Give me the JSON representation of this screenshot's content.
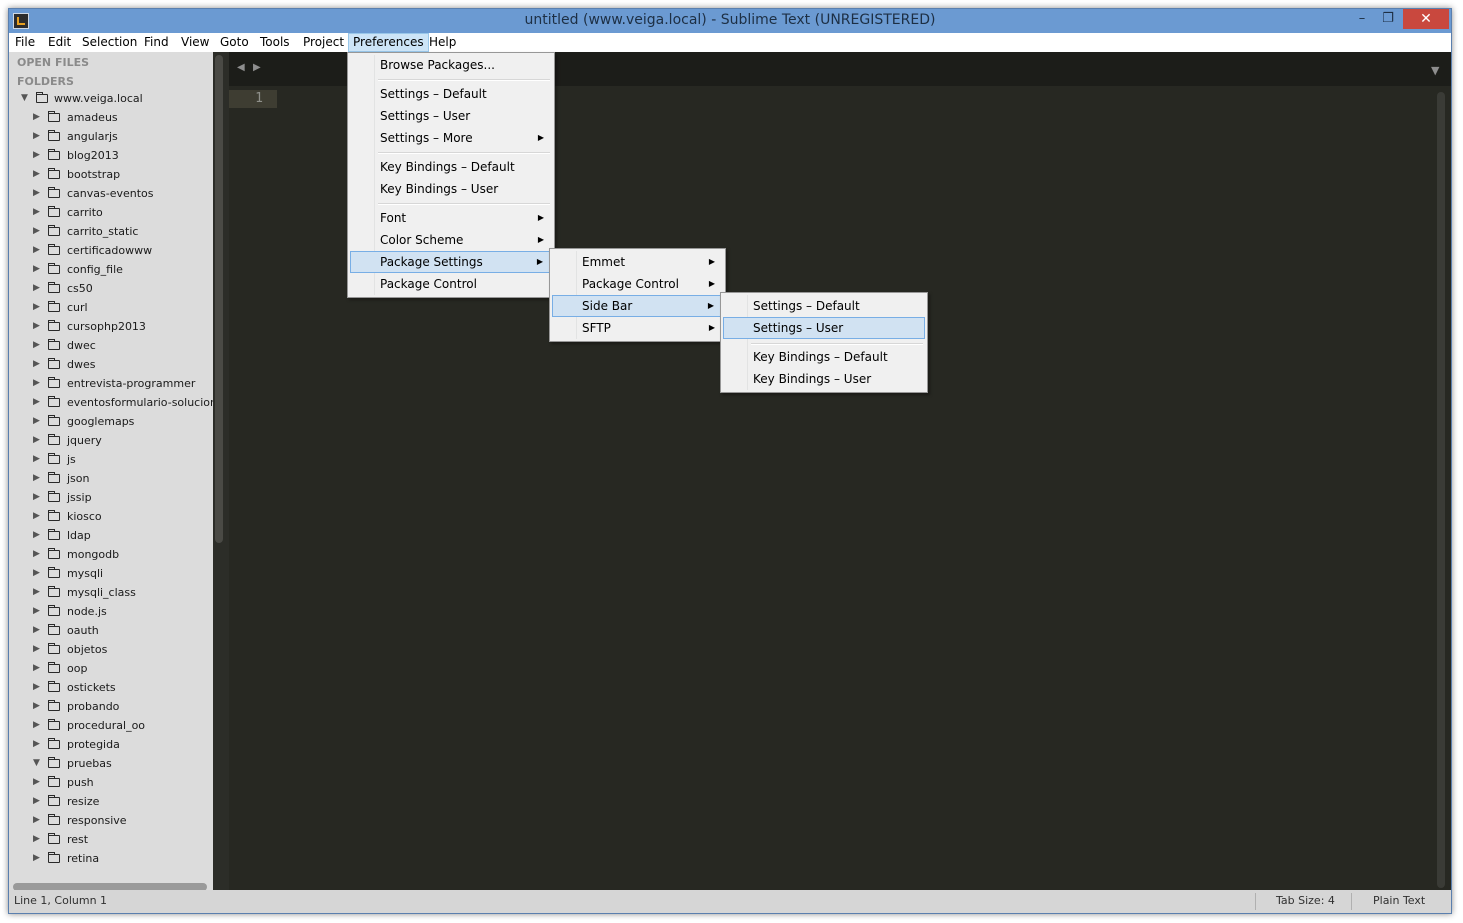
{
  "window": {
    "title": "untitled (www.veiga.local) - Sublime Text (UNREGISTERED)",
    "controls": {
      "minimize": "–",
      "maximize": "❐",
      "close": "✕"
    }
  },
  "menubar": [
    "File",
    "Edit",
    "Selection",
    "Find",
    "View",
    "Goto",
    "Tools",
    "Project",
    "Preferences",
    "Help"
  ],
  "sidebar": {
    "open_files_label": "OPEN FILES",
    "folders_label": "FOLDERS",
    "root": "www.veiga.local",
    "folders": [
      "amadeus",
      "angularjs",
      "blog2013",
      "bootstrap",
      "canvas-eventos",
      "carrito",
      "carrito_static",
      "certificadowww",
      "config_file",
      "cs50",
      "curl",
      "cursophp2013",
      "dwec",
      "dwes",
      "entrevista-programmer",
      "eventosformulario-solucion",
      "googlemaps",
      "jquery",
      "js",
      "json",
      "jssip",
      "kiosco",
      "ldap",
      "mongodb",
      "mysqli",
      "mysqli_class",
      "node.js",
      "oauth",
      "objetos",
      "oop",
      "ostickets",
      "probando",
      "procedural_oo",
      "protegida",
      "pruebas",
      "push",
      "resize",
      "responsive",
      "rest",
      "retina"
    ],
    "expanded_folder": "pruebas"
  },
  "editor": {
    "line_numbers": [
      "1"
    ]
  },
  "preferences_menu": {
    "items": [
      "Browse Packages...",
      "Settings – Default",
      "Settings – User",
      "Settings – More",
      "Key Bindings – Default",
      "Key Bindings – User",
      "Font",
      "Color Scheme",
      "Package Settings",
      "Package Control"
    ]
  },
  "package_settings_menu": {
    "items": [
      "Emmet",
      "Package Control",
      "Side Bar",
      "SFTP"
    ]
  },
  "sidebar_menu": {
    "items": [
      "Settings – Default",
      "Settings – User",
      "Key Bindings – Default",
      "Key Bindings – User"
    ]
  },
  "statusbar": {
    "position": "Line 1, Column 1",
    "tab_size": "Tab Size: 4",
    "syntax": "Plain Text"
  },
  "icons": {
    "submenu_arrow": "▶",
    "tree_collapsed": "▶",
    "tree_expanded": "▼",
    "nav_left": "◀",
    "nav_right": "▶",
    "tabs_dropdown": "▼"
  },
  "colors": {
    "editor_bg": "#272822",
    "sidebar_bg": "#dcdcdc",
    "titlebar_bg": "#6b9ad2",
    "menu_hover": "#d1e2f2"
  }
}
